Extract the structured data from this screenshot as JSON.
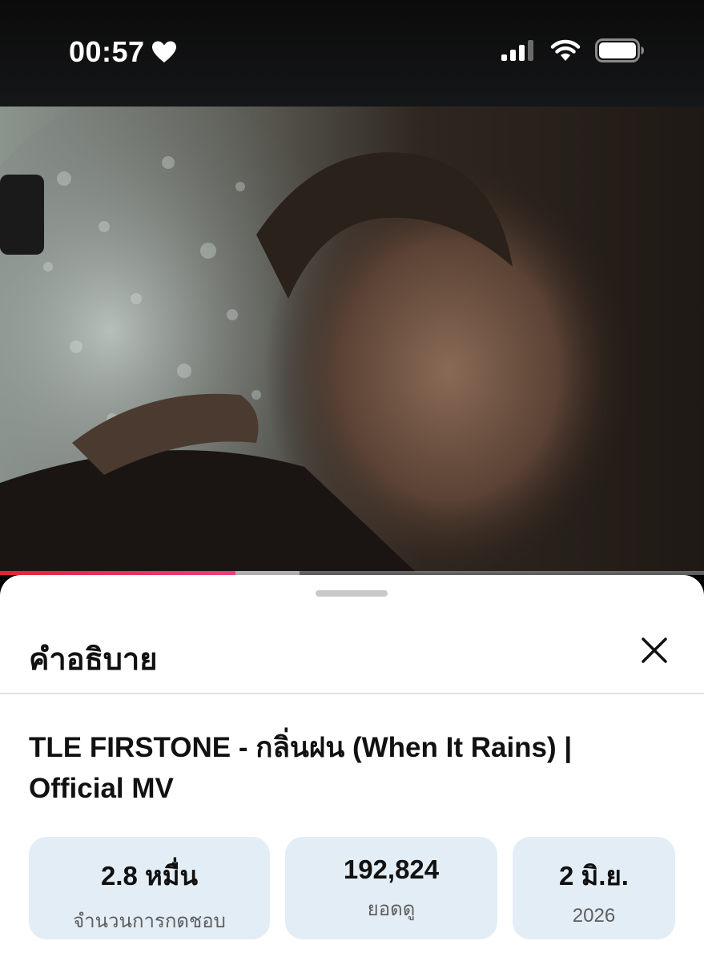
{
  "status_bar": {
    "time": "00:57",
    "heart_icon": "heart-icon",
    "signal_icon": "cellular-signal-icon",
    "wifi_icon": "wifi-icon",
    "battery_icon": "battery-icon"
  },
  "video": {
    "progress_fraction": 0.335,
    "buffered_fraction": 0.425
  },
  "sheet": {
    "title": "คำอธิบาย",
    "close_icon": "close-icon",
    "video_title": "TLE FIRSTONE - กลิ่นฝน (When It Rains) | Official MV",
    "stats": [
      {
        "value": "2.8 หมื่น",
        "label": "จำนวนการกดชอบ"
      },
      {
        "value": "192,824",
        "label": "ยอดดู"
      },
      {
        "value": "2 มิ.ย.",
        "label": "2026"
      }
    ]
  },
  "colors": {
    "progress_red": "#e0233a",
    "stat_bg": "#e3edf6"
  }
}
